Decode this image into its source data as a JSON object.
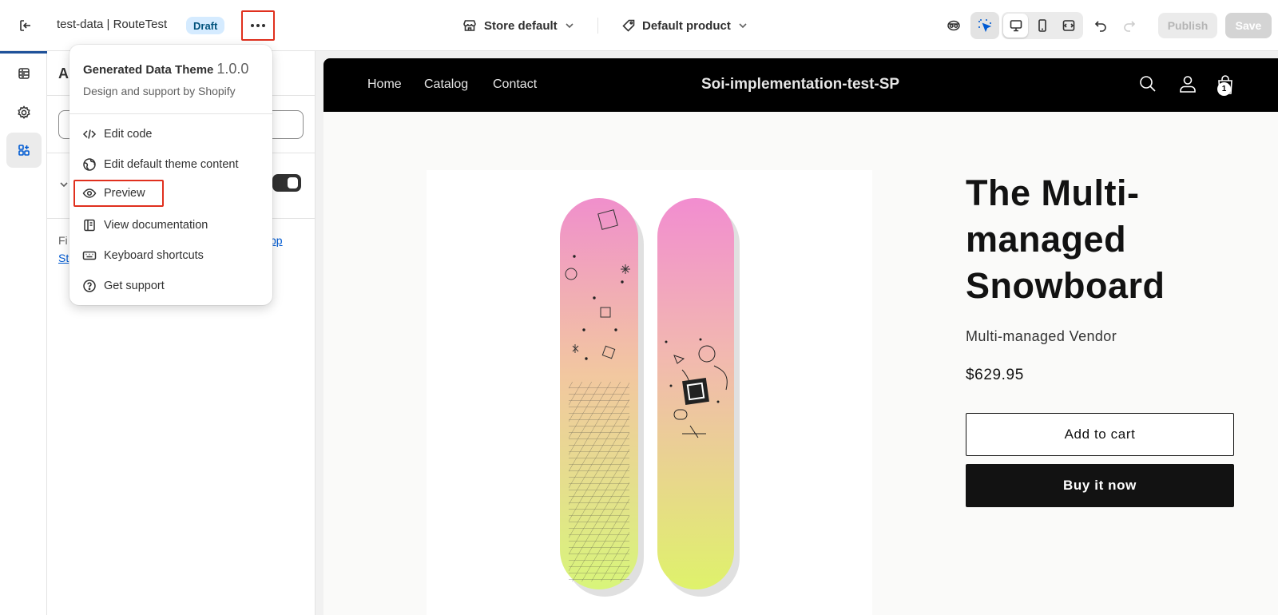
{
  "topbar": {
    "exit_icon": "exit-icon",
    "store_title": "test-data | RouteTest",
    "badge": "Draft",
    "more_icon": "more-horizontal-icon",
    "store_selector": {
      "icon": "store-icon",
      "label": "Store default"
    },
    "product_selector": {
      "icon": "tag-icon",
      "label": "Default product"
    },
    "tools": [
      "app-embed-icon",
      "inspector-icon",
      "desktop-icon",
      "mobile-icon",
      "fullscreen-icon",
      "undo-icon",
      "redo-icon"
    ],
    "publish_label": "Publish",
    "save_label": "Save"
  },
  "rail": {
    "items": [
      {
        "icon": "sections-icon"
      },
      {
        "icon": "settings-icon"
      },
      {
        "icon": "apps-icon",
        "active": true
      }
    ]
  },
  "sidebar": {
    "heading": "A",
    "help_text_start": "Fi",
    "help_link_1": "App",
    "help_link_2": "St"
  },
  "menu": {
    "theme_name": "Generated Data Theme",
    "theme_version": "1.0.0",
    "theme_subtitle": "Design and support by Shopify",
    "items": [
      {
        "label": "Edit code",
        "icon": "code-icon"
      },
      {
        "label": "Edit default theme content",
        "icon": "globe-icon"
      },
      {
        "label": "Preview",
        "icon": "eye-icon"
      },
      {
        "label": "View documentation",
        "icon": "book-icon"
      },
      {
        "label": "Keyboard shortcuts",
        "icon": "keyboard-icon"
      },
      {
        "label": "Get support",
        "icon": "question-circle-icon"
      }
    ]
  },
  "storefront": {
    "nav": [
      "Home",
      "Catalog",
      "Contact"
    ],
    "shop_name": "Soi-implementation-test-SP",
    "cart_count": "1",
    "product": {
      "title": "The Multi-managed Snowboard",
      "vendor": "Multi-managed Vendor",
      "price": "$629.95",
      "add_to_cart": "Add to cart",
      "buy_now": "Buy it now"
    }
  },
  "colors": {
    "highlight": "#e0301e",
    "badge_bg": "#d5ebff",
    "header_bg": "#000000"
  }
}
